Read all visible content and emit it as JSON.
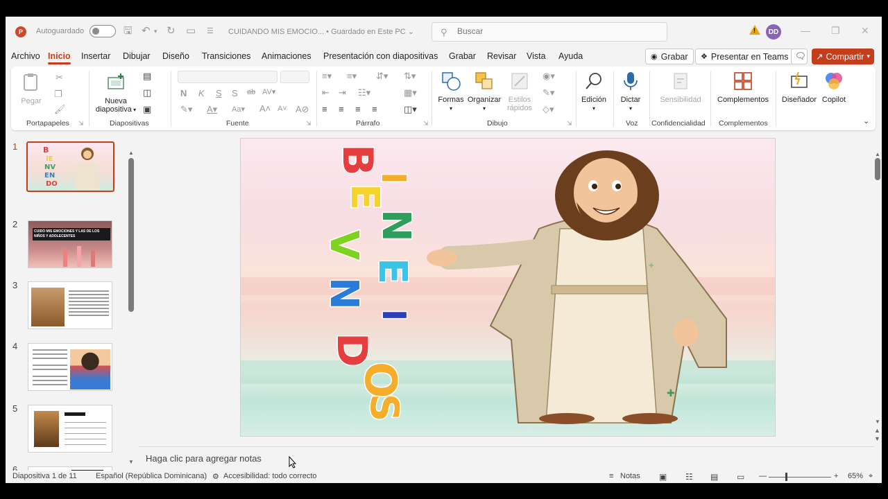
{
  "titlebar": {
    "logo_letter": "P",
    "autosave_label": "Autoguardado",
    "doc_title": "CUIDANDO MIS EMOCIO... • Guardado en Este PC ⌄",
    "search_placeholder": "Buscar",
    "avatar_initials": "DD"
  },
  "tabs": [
    "Archivo",
    "Inicio",
    "Insertar",
    "Dibujar",
    "Diseño",
    "Transiciones",
    "Animaciones",
    "Presentación con diapositivas",
    "Grabar",
    "Revisar",
    "Vista",
    "Ayuda"
  ],
  "actions": {
    "record": "Grabar",
    "teams": "Presentar en Teams",
    "share": "Compartir"
  },
  "ribbon": {
    "paste": "Pegar",
    "new_slide_1": "Nueva",
    "new_slide_2": "diapositiva",
    "bold": "N",
    "italic": "K",
    "underline": "S",
    "shadow": "S",
    "strike": "ab",
    "shapes": "Formas",
    "arrange": "Organizar",
    "quick_styles_1": "Estilos",
    "quick_styles_2": "rápidos",
    "edit": "Edición",
    "dictate": "Dictar",
    "sensitivity": "Sensibilidad",
    "addins": "Complementos",
    "designer": "Diseñador",
    "copilot": "Copilot",
    "groups": {
      "clipboard": "Portapapeles",
      "slides": "Diapositivas",
      "font": "Fuente",
      "paragraph": "Párrafo",
      "drawing": "Dibujo",
      "voice": "Voz",
      "confidentiality": "Confidencialidad",
      "addins": "Complementos"
    }
  },
  "thumbnails": {
    "numbers": [
      "1",
      "2",
      "3",
      "4",
      "5",
      "6"
    ],
    "slide2_title": "CUIDO MIS EMOCIONES Y LAS DE LOS NIÑOS Y ADOLECENTES"
  },
  "slide": {
    "letters": [
      "B",
      "I",
      "E",
      "N",
      "V",
      "E",
      "N",
      "I",
      "D",
      "O",
      "S"
    ]
  },
  "notes_placeholder": "Haga clic para agregar notas",
  "status": {
    "slide_count": "Diapositiva 1 de 11",
    "language": "Español (República Dominicana)",
    "accessibility": "Accesibilidad: todo correcto",
    "notes": "Notas",
    "zoom": "65%"
  }
}
